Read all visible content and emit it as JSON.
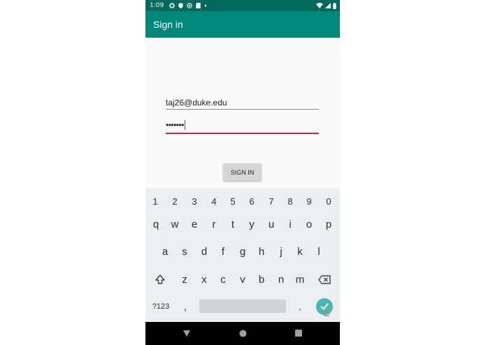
{
  "status_bar": {
    "time": "1:09",
    "left_icons": [
      "settings-icon",
      "shield-icon",
      "sync-icon",
      "sim-card-icon",
      "dot-icon"
    ],
    "right_icons": [
      "wifi-icon",
      "signal-icon",
      "battery-icon"
    ]
  },
  "app_bar": {
    "title": "Sign in"
  },
  "form": {
    "email_value": "taj26@duke.edu",
    "password_masked": "•••••••",
    "sign_in_label": "SIGN IN"
  },
  "keyboard": {
    "number_row": [
      "1",
      "2",
      "3",
      "4",
      "5",
      "6",
      "7",
      "8",
      "9",
      "0"
    ],
    "row1": [
      "q",
      "w",
      "e",
      "r",
      "t",
      "y",
      "u",
      "i",
      "o",
      "p"
    ],
    "row2": [
      "a",
      "s",
      "d",
      "f",
      "g",
      "h",
      "j",
      "k",
      "l"
    ],
    "row3": [
      "z",
      "x",
      "c",
      "v",
      "b",
      "n",
      "m"
    ],
    "symbols_label": "?123",
    "comma_label": ",",
    "period_label": "."
  },
  "colors": {
    "status_bar": "#00695c",
    "app_bar": "#00897b",
    "focus_accent": "#d81b60",
    "enter_key": "#4db6ac"
  }
}
